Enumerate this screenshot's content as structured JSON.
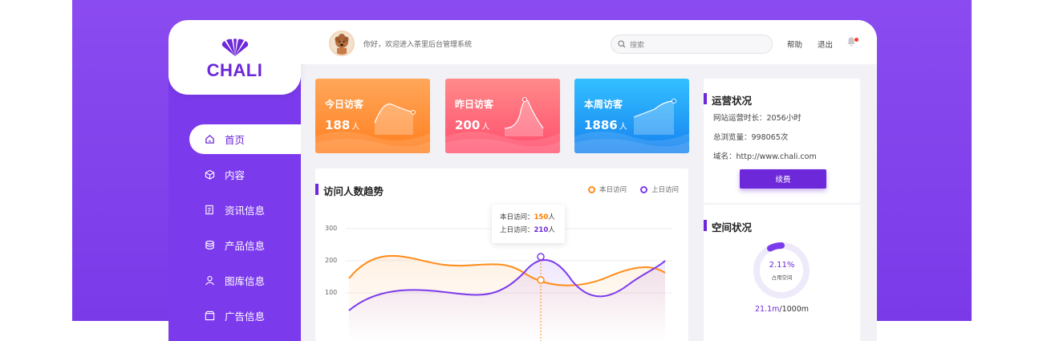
{
  "brand": {
    "name": "CHALI"
  },
  "nav": {
    "items": [
      {
        "label": "首页",
        "icon": "home-icon"
      },
      {
        "label": "内容",
        "icon": "cube-icon"
      },
      {
        "label": "资讯信息",
        "icon": "document-icon"
      },
      {
        "label": "产品信息",
        "icon": "database-icon"
      },
      {
        "label": "图库信息",
        "icon": "user-icon"
      },
      {
        "label": "广告信息",
        "icon": "box-icon"
      }
    ]
  },
  "header": {
    "welcome": "你好，欢迎进入茶里后台管理系统",
    "search_placeholder": "搜索",
    "help": "帮助",
    "logout": "退出"
  },
  "stats": [
    {
      "label": "今日访客",
      "value": "188",
      "unit": "人"
    },
    {
      "label": "昨日访客",
      "value": "200",
      "unit": "人"
    },
    {
      "label": "本周访客",
      "value": "1886",
      "unit": "人"
    }
  ],
  "trend": {
    "title": "访问人数趋势",
    "legend_today": "本日访问",
    "legend_yesterday": "上日访问",
    "tooltip": {
      "today_label": "本日访问：",
      "today_value": "150",
      "yesterday_label": "上日访问：",
      "yesterday_value": "210",
      "unit": "人"
    },
    "y_ticks": [
      "300",
      "200",
      "100"
    ]
  },
  "operations": {
    "title": "运营状况",
    "runtime": "网站运营时长：2056小时",
    "views": "总浏览量：998065次",
    "domain": "域名：http://www.chali.com",
    "renew": "续费"
  },
  "space": {
    "title": "空间状况",
    "percent": "2.11%",
    "used_label": "占用空间",
    "used": "21.1m",
    "total": "/1000m"
  },
  "colors": {
    "accent": "#6d28d9",
    "orange": "#ff8c1a",
    "purple": "#7c3aed"
  }
}
